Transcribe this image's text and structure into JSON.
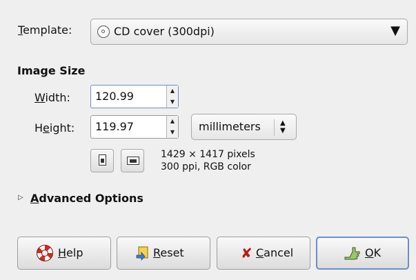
{
  "template": {
    "label": "Template:",
    "value": "CD cover (300dpi)"
  },
  "image_size": {
    "title": "Image Size",
    "width_label": "Width:",
    "width_value": "120.99",
    "height_label": "Height:",
    "height_value": "119.97",
    "unit": "millimeters",
    "info_pixels": "1429 × 1417 pixels",
    "info_color": "300 ppi, RGB color"
  },
  "advanced": {
    "label": "Advanced Options"
  },
  "buttons": {
    "help": "Help",
    "reset": "Reset",
    "cancel": "Cancel",
    "ok": "OK"
  },
  "icons": {
    "template": "cd-icon",
    "help": "lifebuoy-icon",
    "reset": "reset-icon",
    "cancel": "cancel-x-icon",
    "ok": "ok-hand-icon",
    "portrait": "portrait-icon",
    "landscape": "landscape-icon"
  },
  "colors": {
    "focus": "#6b8fc4",
    "cancel_icon": "#b41e12",
    "help_icon": "#d42a1b"
  }
}
